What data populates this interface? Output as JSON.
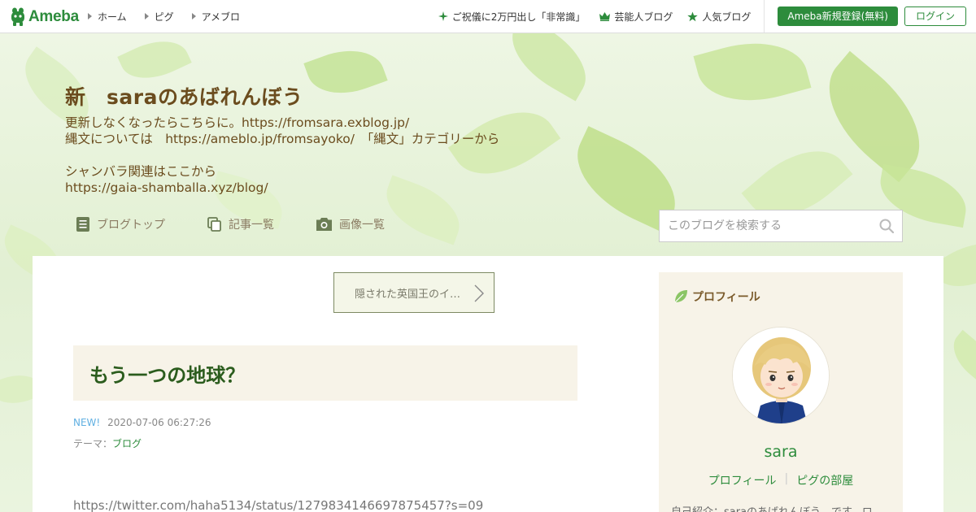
{
  "header": {
    "logo_text": "Ameba",
    "nav": [
      {
        "label": "ホーム"
      },
      {
        "label": "ピグ"
      },
      {
        "label": "アメブロ"
      }
    ],
    "right_links": [
      {
        "label": "ご祝儀に2万円出し「非常識」",
        "icon": "sparkle-icon"
      },
      {
        "label": "芸能人ブログ",
        "icon": "crown-icon"
      },
      {
        "label": "人気ブログ",
        "icon": "star-icon"
      }
    ],
    "register_label": "Ameba新規登録(無料)",
    "login_label": "ログイン"
  },
  "blog": {
    "title": "新　saraのあばれんぼう",
    "desc_lines": [
      "更新しなくなったらこちらに。https://fromsara.exblog.jp/",
      "縄文については　https://ameblo.jp/fromsayoko/　「縄文」カテゴリーから",
      "",
      "シャンバラ関連はここから",
      "https://gaia-shamballa.xyz/blog/"
    ],
    "nav": [
      {
        "label": "ブログトップ",
        "icon": "document-icon"
      },
      {
        "label": "記事一覧",
        "icon": "copy-icon"
      },
      {
        "label": "画像一覧",
        "icon": "camera-icon"
      }
    ],
    "search_placeholder": "このブログを検索する"
  },
  "entry": {
    "prev_title": "隠された英国王のイ…",
    "title": "もう一つの地球？",
    "new_badge": "NEW!",
    "datetime": "2020-07-06 06:27:26",
    "theme_label": "テーマ：",
    "theme_value": "ブログ",
    "body_url": "https://twitter.com/haha5134/status/1279834146697875457?s=09"
  },
  "profile": {
    "heading": "プロフィール",
    "name": "sara",
    "link_profile": "プロフィール",
    "link_room": "ピグの部屋",
    "intro": "自己紹介：saraのあばれんぼう　です。ロ"
  },
  "colors": {
    "brand_green": "#2d8c3c",
    "title_brown": "#6b4c1e",
    "entry_title_green": "#2b5c1d",
    "new_blue": "#61b0e2"
  }
}
